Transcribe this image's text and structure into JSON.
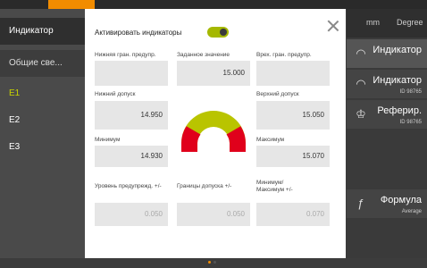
{
  "left_panel": {
    "title": "Индикатор",
    "items": [
      {
        "label": "Общие све..."
      },
      {
        "label": "E1"
      },
      {
        "label": "E2"
      },
      {
        "label": "E3"
      }
    ]
  },
  "dialog": {
    "toggle_label": "Активировать индикаторы",
    "toggle_on": true,
    "fields": {
      "lower_warn": {
        "label": "Нижняя гран. предупр.",
        "value": ""
      },
      "setpoint": {
        "label": "Заданное значение",
        "value": "15.000"
      },
      "upper_warn": {
        "label": "Врех. гран. предупр.",
        "value": ""
      },
      "lower_tol": {
        "label": "Нижний допуск",
        "value": "14.950"
      },
      "upper_tol": {
        "label": "Верхний допуск",
        "value": "15.050"
      },
      "minimum": {
        "label": "Минимум",
        "value": "14.930"
      },
      "maximum": {
        "label": "Максимум",
        "value": "15.070"
      },
      "warn_level": {
        "label": "Уровень предупрежд. +/-",
        "value": "0.050"
      },
      "tol_limits": {
        "label": "Границы допуска +/-",
        "value": "0.050"
      },
      "minmax": {
        "label_line1": "Минимум/",
        "label_line2": "Максимум +/-",
        "value": "0.070"
      }
    },
    "gauge": {
      "outer_color": "#b9c400",
      "inner_color": "#e8e8e8",
      "red_color": "#e0001b",
      "red_fraction_each_side": 0.25
    }
  },
  "right_panel": {
    "units": [
      "mm",
      "Degree"
    ],
    "items": [
      {
        "label": "Индикатор",
        "sub": "",
        "icon": "gauge-icon"
      },
      {
        "label": "Индикатор",
        "sub": "ID 98765",
        "icon": "gauge-icon"
      },
      {
        "label": "Реферир.",
        "sub": "ID 98765",
        "icon": "crown-icon"
      },
      {
        "label": "Формула",
        "sub": "Average",
        "icon": "formula-icon"
      }
    ]
  },
  "colors": {
    "accent": "#f28c00",
    "active_text": "#c8d400"
  }
}
